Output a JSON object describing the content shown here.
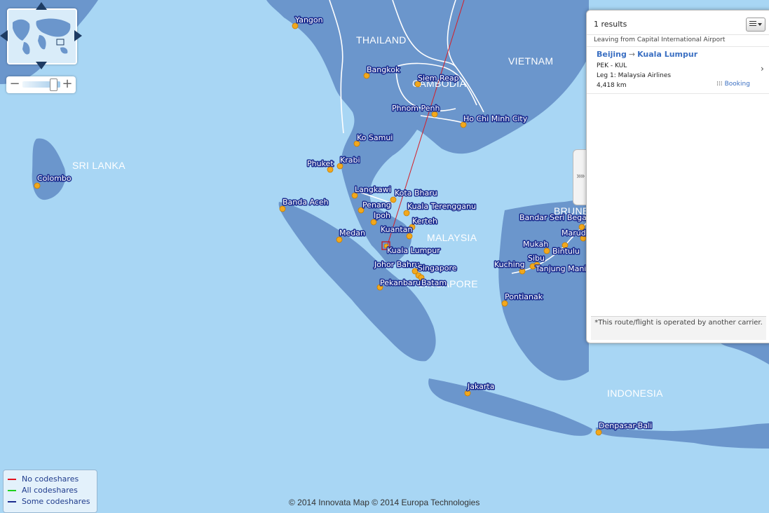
{
  "map": {
    "countries": [
      {
        "name": "THAILAND"
      },
      {
        "name": "VIETNAM"
      },
      {
        "name": "CAMBODIA"
      },
      {
        "name": "SRI LANKA"
      },
      {
        "name": "MALAYSIA"
      },
      {
        "name": "SINGAPORE"
      },
      {
        "name": "BRUNEI"
      },
      {
        "name": "INDONESIA"
      }
    ],
    "cities": [
      {
        "name": "Yangon"
      },
      {
        "name": "Bangkok"
      },
      {
        "name": "Siem Reap"
      },
      {
        "name": "Phnom Penh"
      },
      {
        "name": "Ho Chi Minh City"
      },
      {
        "name": "Ko Samui"
      },
      {
        "name": "Phuket"
      },
      {
        "name": "Krabi"
      },
      {
        "name": "Colombo"
      },
      {
        "name": "Langkawi"
      },
      {
        "name": "Kota Bharu"
      },
      {
        "name": "Penang"
      },
      {
        "name": "Kuala Terengganu"
      },
      {
        "name": "Banda Aceh"
      },
      {
        "name": "Ipoh"
      },
      {
        "name": "Kerteh"
      },
      {
        "name": "Kuantan"
      },
      {
        "name": "Medan"
      },
      {
        "name": "Kuala Lumpur"
      },
      {
        "name": "Johor Bahru"
      },
      {
        "name": "Singapore"
      },
      {
        "name": "Pekanbaru"
      },
      {
        "name": "Batam"
      },
      {
        "name": "Bandar Seri Begawan"
      },
      {
        "name": "Marudi"
      },
      {
        "name": "Mukah"
      },
      {
        "name": "Bintulu"
      },
      {
        "name": "Sibu"
      },
      {
        "name": "Kuching"
      },
      {
        "name": "Tanjung Manis"
      },
      {
        "name": "Pontianak"
      },
      {
        "name": "Jakarta"
      },
      {
        "name": "Denpasar-Bali"
      }
    ],
    "route_color": "#d4202a",
    "copyright": "© 2014 Innovata Map © 2014 Europa Technologies"
  },
  "overview": {
    "name": "world-overview"
  },
  "zoom": {
    "out_label": "−",
    "in_label": "+",
    "level": 0.8
  },
  "panel": {
    "tab_glyph": "»»",
    "results_count": "1 results",
    "leaving_from": "Leaving from Capital International Airport",
    "result": {
      "from": "Beijing",
      "arrow": "→",
      "to": "Kuala Lumpur",
      "codes": "PEK - KUL",
      "leg": "Leg 1: Malaysia Airlines",
      "distance": "4,418 km",
      "booking_icon": "⁞⁞⁞",
      "booking": "Booking",
      "chevron": "›"
    },
    "footnote": "*This route/flight is operated by another carrier."
  },
  "legend": {
    "items": [
      {
        "label": "No codeshares",
        "color": "#e3141f"
      },
      {
        "label": "All codeshares",
        "color": "#1fd11f"
      },
      {
        "label": "Some codeshares",
        "color": "#1d2d8f"
      }
    ]
  }
}
